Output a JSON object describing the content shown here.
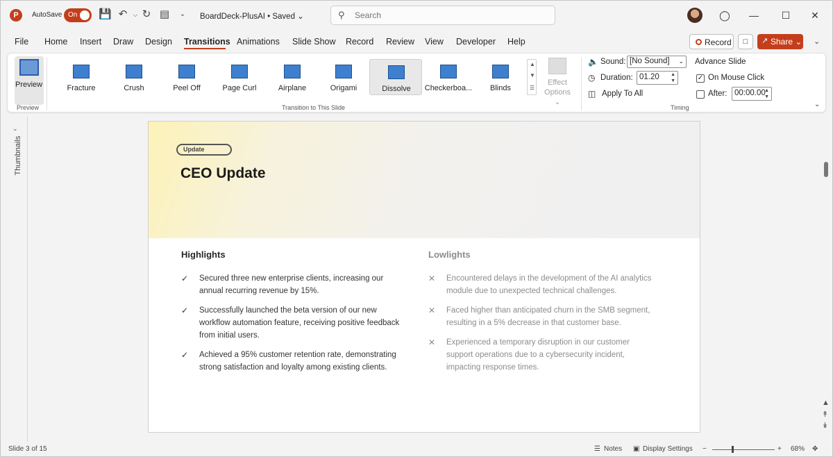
{
  "titlebar": {
    "autosave_label": "AutoSave",
    "autosave_state": "On",
    "doc_title": "BoardDeck-PlusAI • Saved ⌄",
    "search_placeholder": "Search"
  },
  "menu": {
    "tabs": [
      "File",
      "Home",
      "Insert",
      "Draw",
      "Design",
      "Transitions",
      "Animations",
      "Slide Show",
      "Record",
      "Review",
      "View",
      "Developer",
      "Help"
    ],
    "active_tab": "Transitions",
    "record_label": "Record",
    "share_label": "Share ⌄"
  },
  "ribbon": {
    "preview_label": "Preview",
    "preview_group": "Preview",
    "transitions": [
      "Fracture",
      "Crush",
      "Peel Off",
      "Page Curl",
      "Airplane",
      "Origami",
      "Dissolve",
      "Checkerboa...",
      "Blinds"
    ],
    "selected_transition": "Dissolve",
    "transition_group": "Transition to This Slide",
    "effect_options": "Effect Options ⌄",
    "sound_label": "Sound:",
    "sound_value": "[No Sound]",
    "duration_label": "Duration:",
    "duration_value": "01.20",
    "apply_all_label": "Apply To All",
    "advance_label": "Advance Slide",
    "on_mouse_click_label": "On Mouse Click",
    "on_mouse_click_checked": true,
    "after_label": "After:",
    "after_checked": false,
    "after_value": "00:00.00",
    "timing_group": "Timing"
  },
  "thumbnails_label": "Thumbnails",
  "slide": {
    "pill": "Update",
    "title": "CEO Update",
    "highlights_heading": "Highlights",
    "lowlights_heading": "Lowlights",
    "highlights": [
      "Secured three new enterprise clients, increasing our annual recurring revenue by 15%.",
      "Successfully launched the beta version of our new workflow automation feature, receiving positive feedback from initial users.",
      "Achieved a 95% customer retention rate, demonstrating strong satisfaction and loyalty among existing clients."
    ],
    "lowlights": [
      "Encountered delays in the development of the AI analytics module due to unexpected technical challenges.",
      "Faced higher than anticipated churn in the SMB segment, resulting in a 5% decrease in that customer base.",
      "Experienced a temporary disruption in our customer support operations due to a cybersecurity incident, impacting response times."
    ]
  },
  "status": {
    "slide_counter": "Slide 3 of 15",
    "notes_label": "Notes",
    "display_label": "Display Settings",
    "zoom_value": "68%"
  },
  "colors": {
    "accent": "#c43e1c"
  }
}
